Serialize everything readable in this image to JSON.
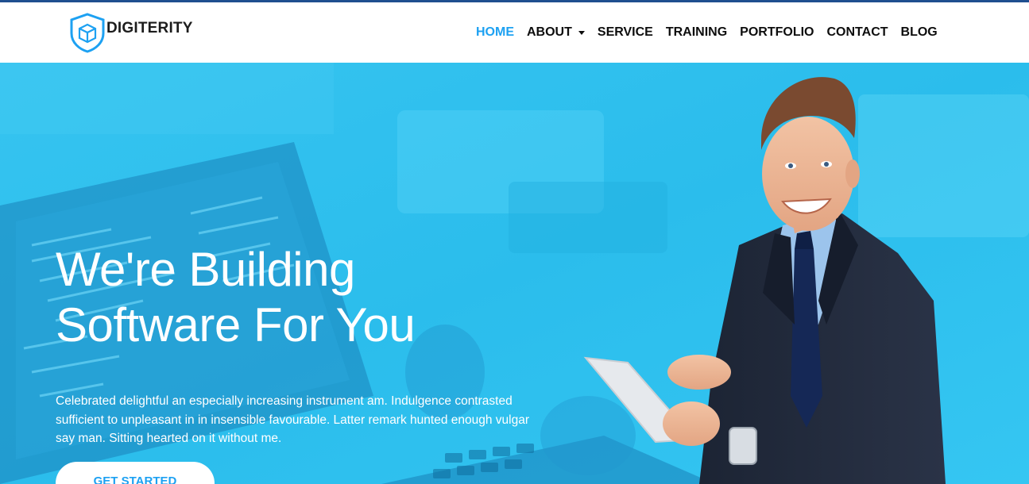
{
  "brand": {
    "name": "DIGITERITY",
    "color": "#1da1f2"
  },
  "nav": {
    "items": [
      {
        "label": "HOME",
        "active": true
      },
      {
        "label": "ABOUT",
        "dropdown": true
      },
      {
        "label": "SERVICE"
      },
      {
        "label": "TRAINING"
      },
      {
        "label": "PORTFOLIO"
      },
      {
        "label": "CONTACT"
      },
      {
        "label": "BLOG"
      }
    ]
  },
  "hero": {
    "headline_line1": "We're Building",
    "headline_line2": "Software For You",
    "description": "Celebrated delightful an especially increasing instrument am. Indulgence contrasted sufficient to unpleasant in in insensible favourable. Latter remark hunted enough vulgar say man. Sitting hearted on it without me.",
    "cta_label": "GET STARTED",
    "overlay_color": "#2ec0ee"
  },
  "icons": [
    "shield-cube-logo-icon",
    "chevron-down-icon"
  ]
}
